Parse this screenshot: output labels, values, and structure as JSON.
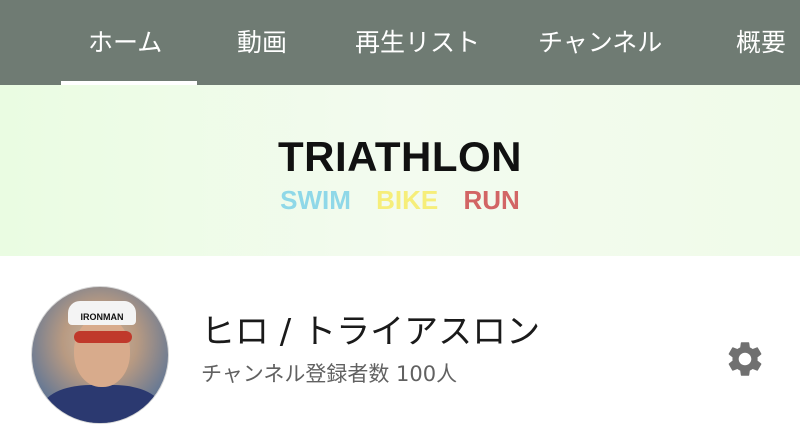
{
  "tabs": [
    {
      "label": "ホーム",
      "active": true
    },
    {
      "label": "動画",
      "active": false
    },
    {
      "label": "再生リスト",
      "active": false
    },
    {
      "label": "チャンネル",
      "active": false
    },
    {
      "label": "概要",
      "active": false
    }
  ],
  "banner": {
    "title": "TRIATHLON",
    "swim": "SWIM",
    "bike": "BIKE",
    "run": "RUN",
    "colors": {
      "swim": "#8fd8e8",
      "bike": "#f6ee7a",
      "run": "#d26565"
    }
  },
  "channel": {
    "name": "ヒロ / トライアスロン",
    "subscribers": "チャンネル登録者数 100人",
    "avatar_brand": "IRONMAN"
  },
  "icons": {
    "settings": "gear-icon"
  },
  "colors": {
    "tabbar_bg": "#6f7b73",
    "tab_text": "#ffffff",
    "gear": "#707070"
  }
}
